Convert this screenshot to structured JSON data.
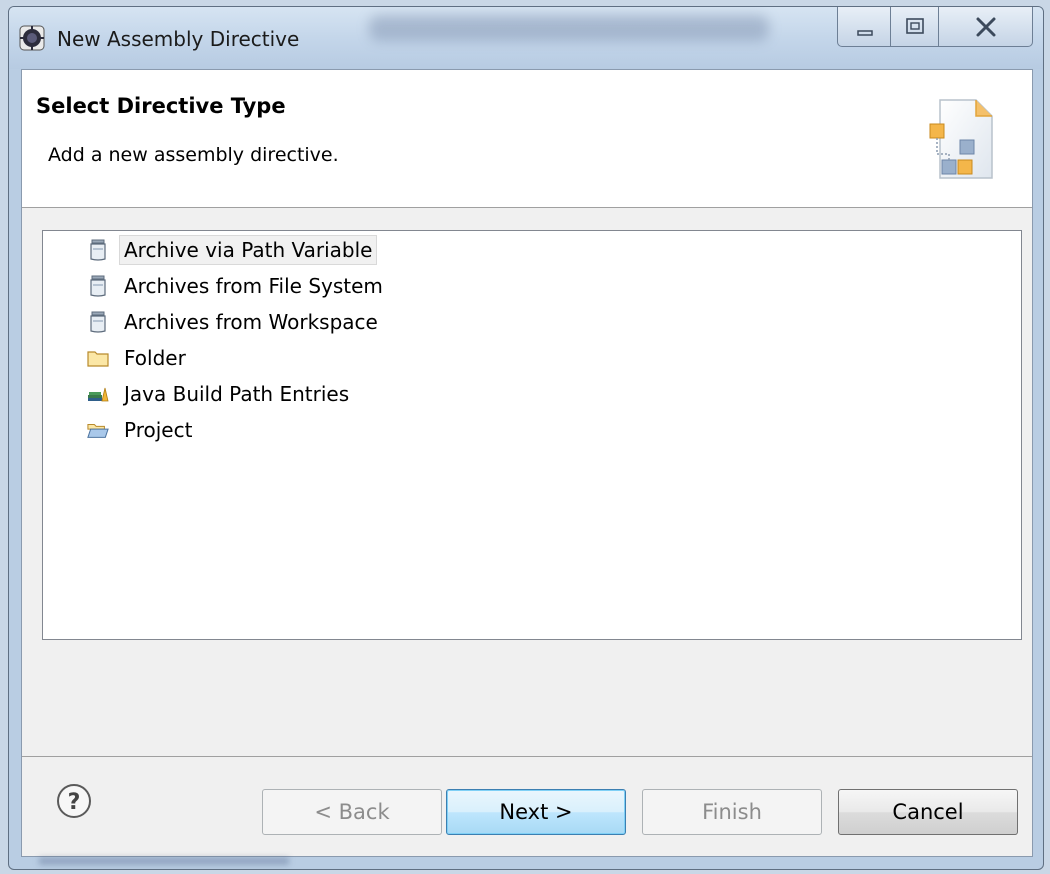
{
  "window": {
    "title": "New Assembly Directive"
  },
  "header": {
    "title": "Select Directive Type",
    "description": "Add a new assembly directive."
  },
  "directives": [
    {
      "label": "Archive via Path Variable",
      "icon": "jar-icon",
      "selected": true
    },
    {
      "label": "Archives from File System",
      "icon": "jar-icon",
      "selected": false
    },
    {
      "label": "Archives from Workspace",
      "icon": "jar-icon",
      "selected": false
    },
    {
      "label": "Folder",
      "icon": "folder-icon",
      "selected": false
    },
    {
      "label": "Java Build Path Entries",
      "icon": "library-icon",
      "selected": false
    },
    {
      "label": "Project",
      "icon": "open-folder-icon",
      "selected": false
    }
  ],
  "buttons": {
    "back": "< Back",
    "next": "Next >",
    "finish": "Finish",
    "cancel": "Cancel"
  },
  "colors": {
    "default_button": "#bee6fd",
    "selection": "#f1f1f1",
    "title_bar": "#c4d6ea"
  }
}
